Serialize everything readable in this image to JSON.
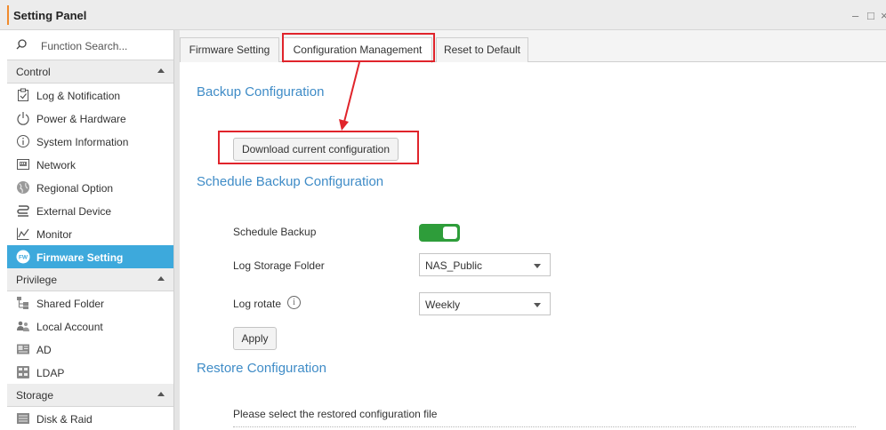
{
  "window": {
    "title": "Setting Panel",
    "minimize": "–",
    "maximize": "□",
    "close": "×"
  },
  "colors": {
    "accent": "#3da9dc",
    "heading": "#3f8cc7",
    "toggle_on": "#2e9d3a",
    "annotation": "#e0242b"
  },
  "sidebar": {
    "search_placeholder": "Function Search...",
    "sections": [
      {
        "label": "Control",
        "items": [
          {
            "label": "Log & Notification",
            "icon": "log-icon"
          },
          {
            "label": "Power & Hardware",
            "icon": "power-icon"
          },
          {
            "label": "System Information",
            "icon": "info-icon"
          },
          {
            "label": "Network",
            "icon": "network-icon"
          },
          {
            "label": "Regional Option",
            "icon": "globe-icon"
          },
          {
            "label": "External Device",
            "icon": "usb-icon"
          },
          {
            "label": "Monitor",
            "icon": "monitor-icon"
          },
          {
            "label": "Firmware Setting",
            "icon": "fw-icon",
            "active": true
          }
        ]
      },
      {
        "label": "Privilege",
        "items": [
          {
            "label": "Shared Folder",
            "icon": "shared-folder-icon"
          },
          {
            "label": "Local Account",
            "icon": "users-icon"
          },
          {
            "label": "AD",
            "icon": "ad-icon"
          },
          {
            "label": "LDAP",
            "icon": "ldap-icon"
          }
        ]
      },
      {
        "label": "Storage",
        "items": [
          {
            "label": "Disk & Raid",
            "icon": "disk-icon"
          }
        ]
      }
    ]
  },
  "tabs": [
    {
      "label": "Firmware Setting"
    },
    {
      "label": "Configuration Management",
      "active": true
    },
    {
      "label": "Reset to Default"
    }
  ],
  "backup": {
    "heading": "Backup Configuration",
    "download_button": "Download current configuration"
  },
  "schedule": {
    "heading": "Schedule Backup Configuration",
    "schedule_label": "Schedule Backup",
    "schedule_enabled": true,
    "folder_label": "Log Storage Folder",
    "folder_value": "NAS_Public",
    "rotate_label": "Log rotate",
    "rotate_info": "i",
    "rotate_value": "Weekly",
    "apply_button": "Apply"
  },
  "restore": {
    "heading": "Restore Configuration",
    "instruction": "Please select the restored configuration file"
  }
}
